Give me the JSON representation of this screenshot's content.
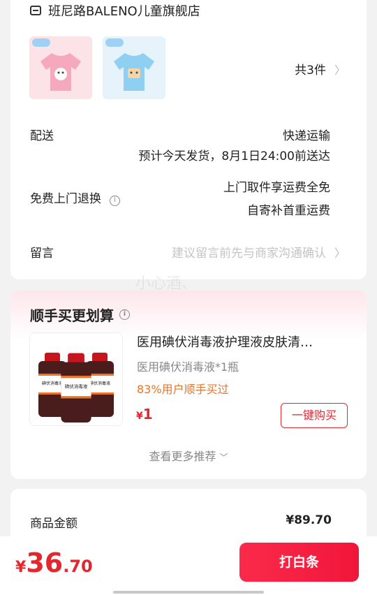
{
  "shop": {
    "name": "班尼路BALENO儿童旗舰店",
    "icon": "shop-icon"
  },
  "order": {
    "thumbnails": [
      "pink-tshirt",
      "blue-tshirt"
    ],
    "item_count": "共3件",
    "delivery": {
      "label": "配送",
      "method": "快递运输",
      "eta": "预计今天发货，8月1日24:00前送达"
    },
    "returns": {
      "label": "免费上门退换",
      "line1": "上门取件享运费全免",
      "line2": "自寄补首重运费"
    },
    "message": {
      "label": "留言",
      "placeholder": "建议留言前先与商家沟通确认"
    }
  },
  "watermark": "小心酒、",
  "recommend": {
    "title": "顺手买更划算",
    "product": {
      "title": "医用碘伏消毒液护理液皮肤清…",
      "spec": "医用碘伏消毒液*1瓶",
      "percent": "83%用户顺手买过",
      "price_symbol": "¥",
      "price": "1",
      "buy_label": "一键购买",
      "bottle_label": "碘伏消毒液"
    },
    "more": "查看更多推荐"
  },
  "summary": {
    "label": "商品金额",
    "value": "¥89.70"
  },
  "bottom": {
    "symbol": "¥",
    "integer": "36",
    "decimal": ".70",
    "pay_label": "打白条"
  },
  "colors": {
    "accent": "#e4262e",
    "orange": "#e8742a",
    "pay_button": "#f0163a"
  }
}
